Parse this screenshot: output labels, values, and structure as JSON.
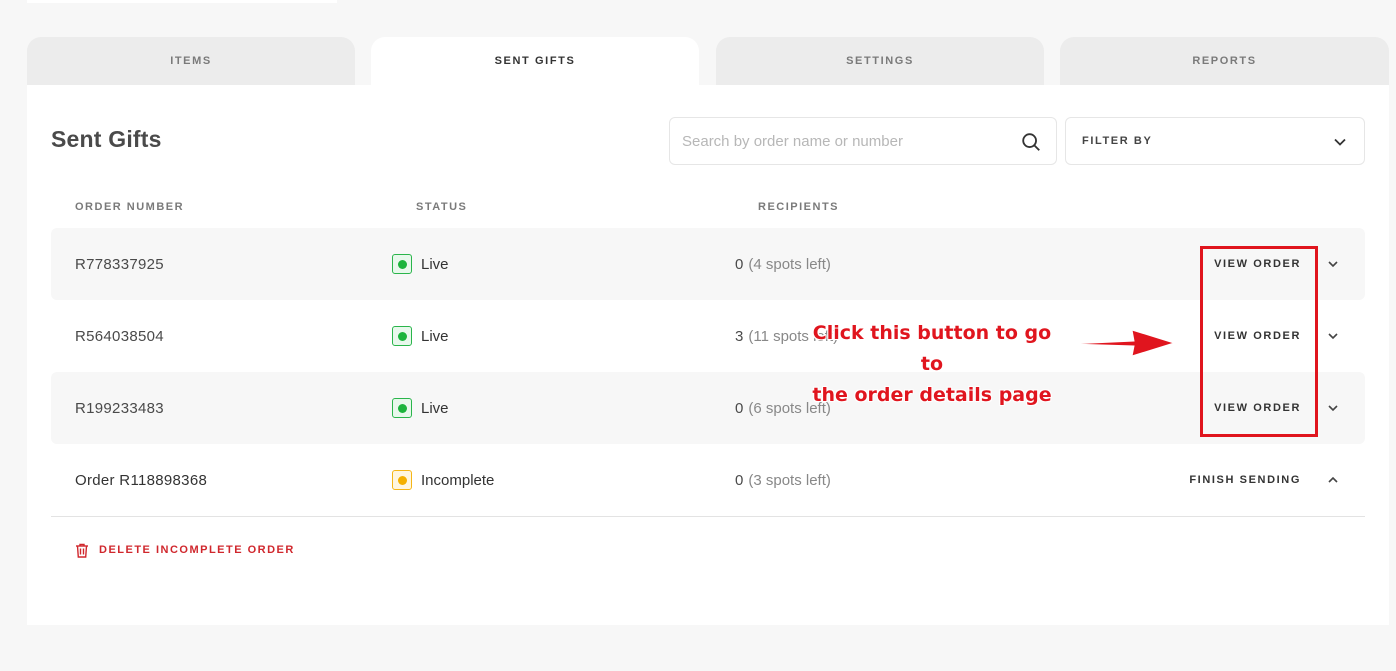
{
  "tabs": [
    {
      "label": "ITEMS",
      "active": false
    },
    {
      "label": "SENT GIFTS",
      "active": true
    },
    {
      "label": "SETTINGS",
      "active": false
    },
    {
      "label": "REPORTS",
      "active": false
    }
  ],
  "header": {
    "title": "Sent Gifts",
    "search_placeholder": "Search by order name or number",
    "filter_label": "FILTER BY"
  },
  "table": {
    "columns": [
      "ORDER NUMBER",
      "STATUS",
      "RECIPIENTS"
    ],
    "rows": [
      {
        "order": "R778337925",
        "status": "Live",
        "recipients": "0",
        "spots": "(4 spots left)",
        "action": "VIEW ORDER"
      },
      {
        "order": "R564038504",
        "status": "Live",
        "recipients": "3",
        "spots": "(11 spots left)",
        "action": "VIEW ORDER"
      },
      {
        "order": "R199233483",
        "status": "Live",
        "recipients": "0",
        "spots": "(6 spots left)",
        "action": "VIEW ORDER"
      },
      {
        "order": "Order R118898368",
        "status": "Incomplete",
        "recipients": "0",
        "spots": "(3 spots left)",
        "action": "FINISH SENDING"
      }
    ]
  },
  "delete_label": "DELETE INCOMPLETE ORDER",
  "annotation": {
    "line1": "Click this button to go to",
    "line2": "the order details page"
  },
  "colors": {
    "live": "#1cb43c",
    "incomplete": "#f4b000",
    "danger": "#d0272d",
    "annotation": "#e0151e"
  }
}
